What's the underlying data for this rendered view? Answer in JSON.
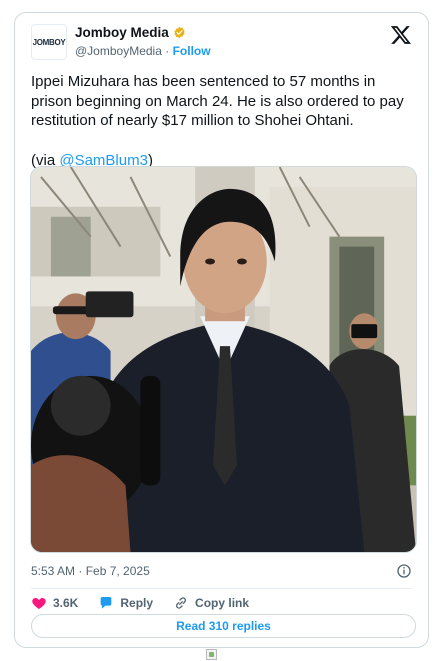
{
  "account": {
    "name": "Jomboy Media",
    "handle": "@JomboyMedia",
    "separator": "·",
    "follow_label": "Follow",
    "avatar_text": "JOMBOY",
    "verified_color": "#e8b21a"
  },
  "tweet": {
    "text": "Ippei Mizuhara has been sentenced to 57 months in prison beginning on March 24. He is also ordered to pay restitution of nearly $17 million to Shohei Ohtani.",
    "via_prefix": "(via ",
    "via_mention": "@SamBlum3",
    "via_suffix": ")"
  },
  "meta": {
    "timestamp": "5:53 AM · Feb 7, 2025"
  },
  "actions": {
    "likes": "3.6K",
    "reply_label": "Reply",
    "copy_link_label": "Copy link",
    "read_replies_label": "Read 310 replies"
  },
  "colors": {
    "accent": "#1d9bf0",
    "like": "#f91880",
    "border": "#cfd9de"
  },
  "icons": [
    "verified-icon",
    "x-logo-icon",
    "info-icon",
    "heart-icon",
    "reply-bubble-icon",
    "link-icon",
    "broken-image-icon"
  ]
}
